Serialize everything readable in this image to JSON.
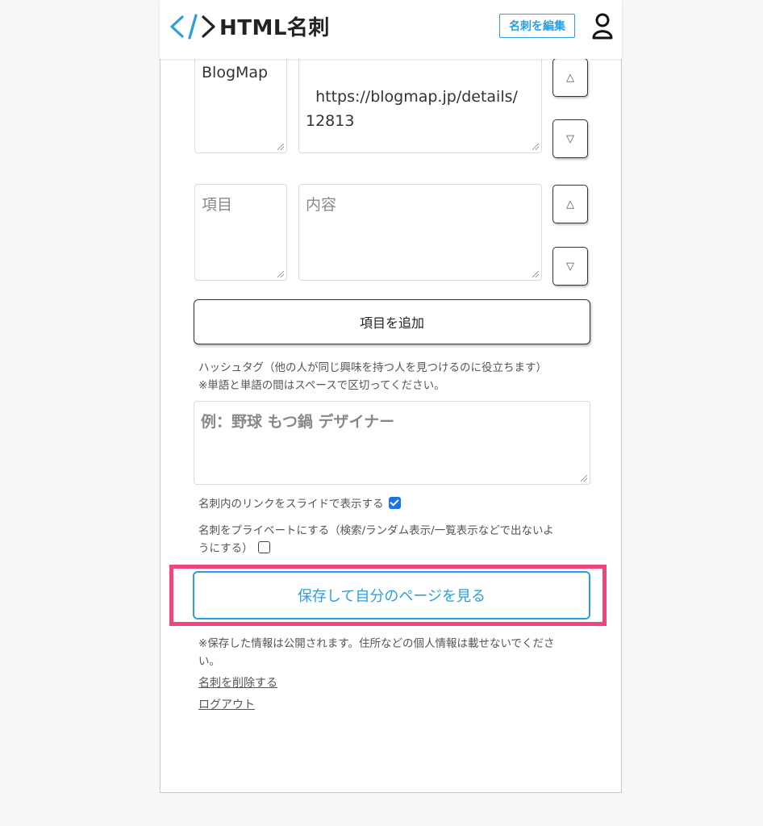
{
  "header": {
    "logo_text": "HTML名刺",
    "edit_button": "名刺を編集"
  },
  "links": [
    {
      "label": "BlogMap",
      "url": "https://blogmap.jp/details/\n12813"
    },
    {
      "label_placeholder": "項目",
      "content_placeholder": "内容"
    }
  ],
  "arrows": {
    "up": "△",
    "down": "▽"
  },
  "add_item_button": "項目を追加",
  "hashtag": {
    "help_line1": "ハッシュタグ（他の人が同じ興味を持つ人を見つけるのに役立ちます）",
    "help_line2": "※単語と単語の間はスペースで区切ってください。",
    "placeholder": "例：野球 もつ鍋 デザイナー"
  },
  "options": {
    "slide_label": "名刺内のリンクをスライドで表示する",
    "slide_checked": true,
    "private_label_line1": "名刺をプライベートにする（検索/ランダム表示/一覧表示などで出ないよ",
    "private_label_line2": "うにする）",
    "private_checked": false
  },
  "save_button": "保存して自分のページを見る",
  "notice_line1": "※保存した情報は公開されます。住所などの個人情報は載せないでくださ",
  "notice_line2": "い。",
  "delete_link": "名刺を削除する",
  "logout_link": "ログアウト",
  "colors": {
    "accent": "#2a9fe0",
    "highlight": "#f0457a",
    "checkbox": "#1a73e8"
  }
}
